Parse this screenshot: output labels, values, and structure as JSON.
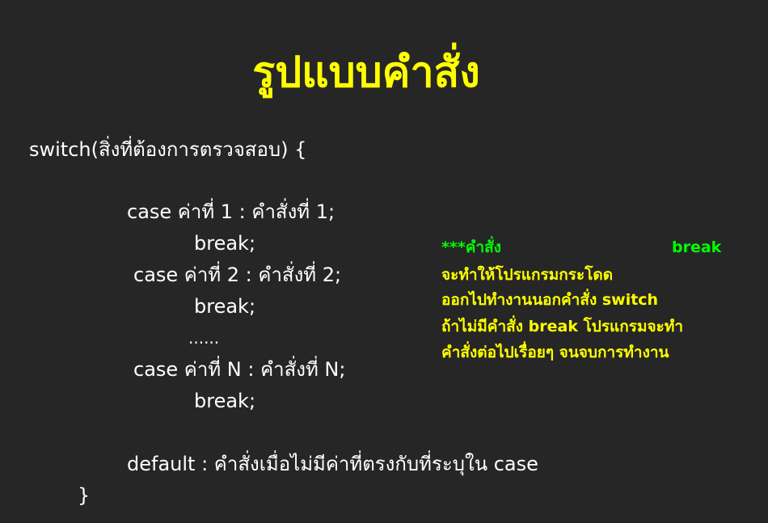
{
  "colors": {
    "background": "#262626",
    "title": "#ffff00",
    "code_text": "#ffffff",
    "note_heading": "#00ff00",
    "note_text": "#ffff00"
  },
  "title": "รูปแบบคำสั่ง",
  "code": {
    "switch_open": "switch(สิ่งที่ต้องการตรวจสอบ) {",
    "case1": "case ค่าที่ 1 : คำสั่งที่ 1;",
    "break1": "break;",
    "case2": "case ค่าที่ 2 : คำสั่งที่ 2;",
    "break2": "break;",
    "ellipsis": "......",
    "caseN": "case ค่าที่ N : คำสั่งที่ N;",
    "breakN": "break;",
    "default_line": "default : คำสั่งเมื่อไม่มีค่าที่ตรงกับที่ระบุใน case",
    "close_brace": "}"
  },
  "note": {
    "heading_left": "***คำสั่ง",
    "heading_right": "break",
    "line1": "จะทำให้โปรแกรมกระโดด",
    "line2": "ออกไปทำงานนอกคำสั่ง switch",
    "line3": "ถ้าไม่มีคำสั่ง break โปรแกรมจะทำ",
    "line4": "คำสั่งต่อไปเรื่อยๆ จนจบการทำงาน"
  }
}
